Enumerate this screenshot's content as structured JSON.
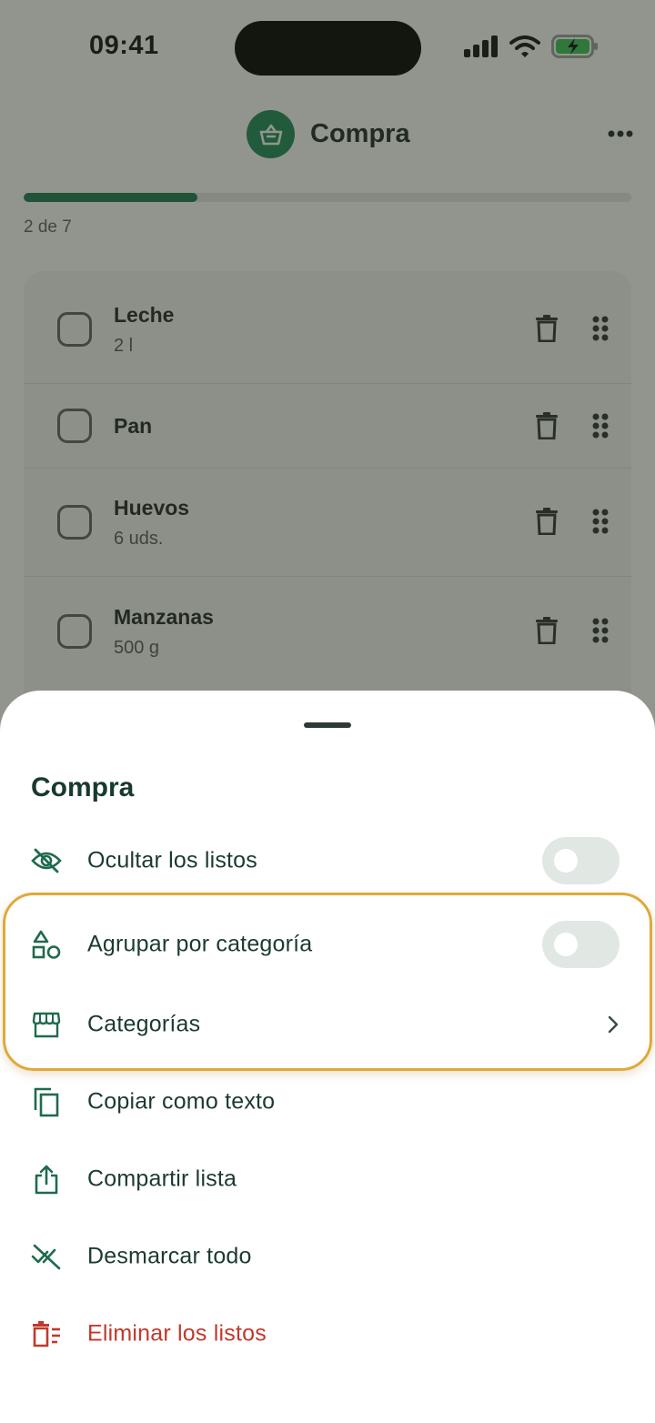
{
  "status_bar": {
    "time": "09:41"
  },
  "header": {
    "title": "Compra",
    "icon": "basket-icon",
    "more_icon": "more-horizontal-icon"
  },
  "progress": {
    "label": "2 de 7",
    "fraction": 0.2857
  },
  "items": [
    {
      "name": "Leche",
      "quantity": "2 l"
    },
    {
      "name": "Pan",
      "quantity": ""
    },
    {
      "name": "Huevos",
      "quantity": "6 uds."
    },
    {
      "name": "Manzanas",
      "quantity": "500 g"
    }
  ],
  "sheet": {
    "title": "Compra",
    "options": [
      {
        "label": "Ocultar los listos",
        "icon": "eye-off-icon",
        "control": "toggle",
        "on": false
      },
      {
        "label": "Agrupar por categoría",
        "icon": "shapes-icon",
        "control": "toggle",
        "on": false
      },
      {
        "label": "Categorías",
        "icon": "store-icon",
        "control": "chevron"
      },
      {
        "label": "Copiar como texto",
        "icon": "copy-icon"
      },
      {
        "label": "Compartir lista",
        "icon": "share-icon"
      },
      {
        "label": "Desmarcar todo",
        "icon": "uncheck-all-icon"
      },
      {
        "label": "Eliminar los listos",
        "icon": "delete-list-icon",
        "danger": true
      }
    ]
  },
  "colors": {
    "brand_green": "#1f8a5b",
    "progress_fill": "#1a7a50",
    "danger_red": "#c0392b",
    "highlight_border": "#e0a93a"
  }
}
